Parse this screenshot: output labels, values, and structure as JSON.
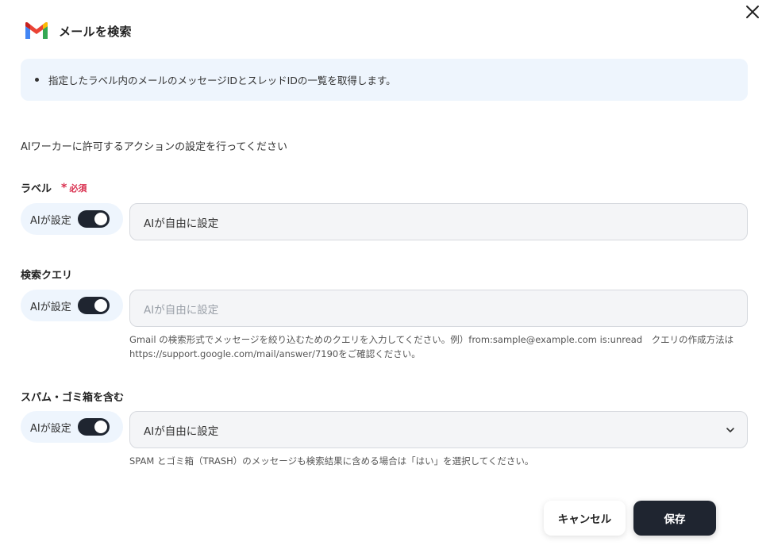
{
  "dialog": {
    "title": "メールを検索",
    "logo_icon": "gmail-logo",
    "close_icon": "close-icon"
  },
  "info": {
    "items": [
      "指定したラベル内のメールのメッセージIDとスレッドIDの一覧を取得します。"
    ]
  },
  "intro": "AIワーカーに許可するアクションの設定を行ってください",
  "fields": [
    {
      "label": "ラベル",
      "required_mark": "*",
      "required_text": "必須",
      "toggle_label": "AIが設定",
      "toggle_on": true,
      "input_value": "AIが自由に設定",
      "placeholder": ""
    },
    {
      "label": "検索クエリ",
      "toggle_label": "AIが設定",
      "toggle_on": true,
      "input_value": "",
      "placeholder": "AIが自由に設定",
      "help_line1": "Gmail の検索形式でメッセージを絞り込むためのクエリを入力してください。例）from:sample@example.com is:unread　クエリの作成方法は",
      "help_line2": "https://support.google.com/mail/answer/7190をご確認ください。"
    },
    {
      "label": "スパム・ゴミ箱を含む",
      "toggle_label": "AIが設定",
      "toggle_on": true,
      "select_value": "AIが自由に設定",
      "select_icon": "chevron-down-icon",
      "help_line1": "SPAM とゴミ箱（TRASH）のメッセージも検索結果に含める場合は「はい」を選択してください。"
    }
  ],
  "buttons": {
    "cancel": "キャンセル",
    "save": "保存"
  },
  "colors": {
    "accent_dark": "#1f2530",
    "info_bg": "#eef5fd",
    "required": "#d9304f",
    "gmail_red": "#EA4335",
    "gmail_blue": "#4285F4",
    "gmail_green": "#34A853",
    "gmail_yellow": "#FBBC04"
  }
}
